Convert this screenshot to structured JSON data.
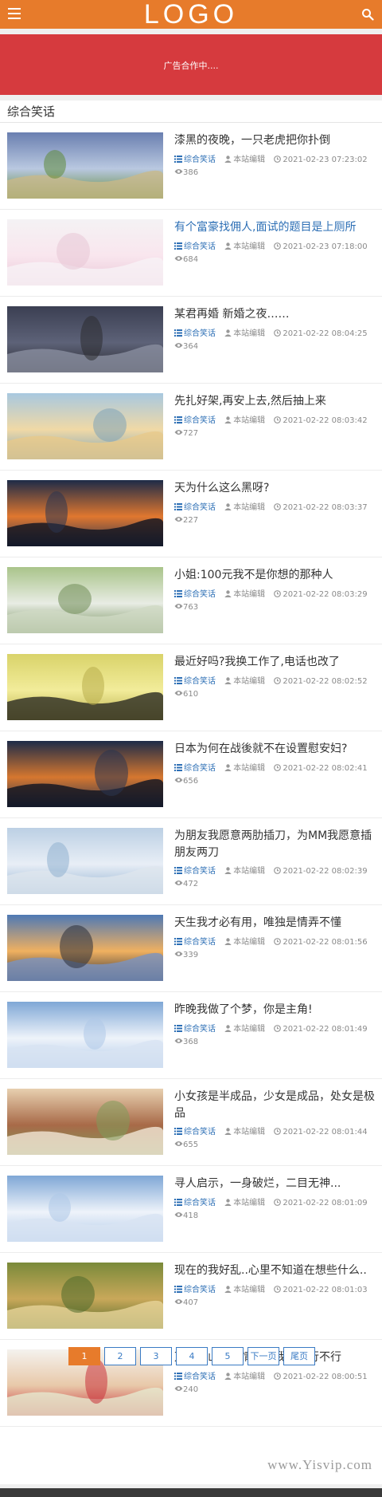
{
  "header": {
    "logo": "LOGO"
  },
  "ad": {
    "text": "广告合作中...."
  },
  "section": {
    "title": "综合笑话"
  },
  "articles": [
    {
      "title": "漆黑的夜晚，一只老虎把你扑倒",
      "category": "综合笑话",
      "author": "本站编辑",
      "date": "2021-02-23 07:23:02",
      "views": "386",
      "highlighted": false
    },
    {
      "title": "有个富豪找佣人,面试的题目是上厕所",
      "category": "综合笑话",
      "author": "本站编辑",
      "date": "2021-02-23 07:18:00",
      "views": "684",
      "highlighted": true
    },
    {
      "title": "某君再婚 新婚之夜……",
      "category": "综合笑话",
      "author": "本站编辑",
      "date": "2021-02-22 08:04:25",
      "views": "364",
      "highlighted": false
    },
    {
      "title": "先扎好架,再安上去,然后抽上来",
      "category": "综合笑话",
      "author": "本站编辑",
      "date": "2021-02-22 08:03:42",
      "views": "727",
      "highlighted": false
    },
    {
      "title": "天为什么这么黑呀?",
      "category": "综合笑话",
      "author": "本站编辑",
      "date": "2021-02-22 08:03:37",
      "views": "227",
      "highlighted": false
    },
    {
      "title": "小姐:100元我不是你想的那种人",
      "category": "综合笑话",
      "author": "本站编辑",
      "date": "2021-02-22 08:03:29",
      "views": "763",
      "highlighted": false
    },
    {
      "title": "最近好吗?我换工作了,电话也改了",
      "category": "综合笑话",
      "author": "本站编辑",
      "date": "2021-02-22 08:02:52",
      "views": "610",
      "highlighted": false
    },
    {
      "title": "日本为何在战後就不在设置慰安妇?",
      "category": "综合笑话",
      "author": "本站编辑",
      "date": "2021-02-22 08:02:41",
      "views": "656",
      "highlighted": false
    },
    {
      "title": "为朋友我愿意两肋插刀，为MM我愿意插朋友两刀",
      "category": "综合笑话",
      "author": "本站编辑",
      "date": "2021-02-22 08:02:39",
      "views": "472",
      "highlighted": false
    },
    {
      "title": "天生我才必有用，唯独是情弄不懂",
      "category": "综合笑话",
      "author": "本站编辑",
      "date": "2021-02-22 08:01:56",
      "views": "339",
      "highlighted": false
    },
    {
      "title": "昨晚我做了个梦，你是主角!",
      "category": "综合笑话",
      "author": "本站编辑",
      "date": "2021-02-22 08:01:49",
      "views": "368",
      "highlighted": false
    },
    {
      "title": "小女孩是半成品，少女是成品，处女是极品",
      "category": "综合笑话",
      "author": "本站编辑",
      "date": "2021-02-22 08:01:44",
      "views": "655",
      "highlighted": false
    },
    {
      "title": "寻人启示，一身破烂，二目无神...",
      "category": "综合笑话",
      "author": "本站编辑",
      "date": "2021-02-22 08:01:09",
      "views": "418",
      "highlighted": false
    },
    {
      "title": "现在的我好乱..心里不知道在想些什么..",
      "category": "综合笑话",
      "author": "本站编辑",
      "date": "2021-02-22 08:01:03",
      "views": "407",
      "highlighted": false
    },
    {
      "title": "万水千山总是情，请我吃饭行不行",
      "category": "综合笑话",
      "author": "本站编辑",
      "date": "2021-02-22 08:00:51",
      "views": "240",
      "highlighted": false
    }
  ],
  "pagination": {
    "pages": [
      "1",
      "2",
      "3",
      "4",
      "5"
    ],
    "current": "1",
    "next": "下一页",
    "last": "尾页"
  },
  "watermark": "www.Yisvip.com",
  "colors": {
    "header": "#e77b2b",
    "ad": "#d63a3e",
    "link": "#2d6fb5",
    "accent": "#e77b2b"
  }
}
